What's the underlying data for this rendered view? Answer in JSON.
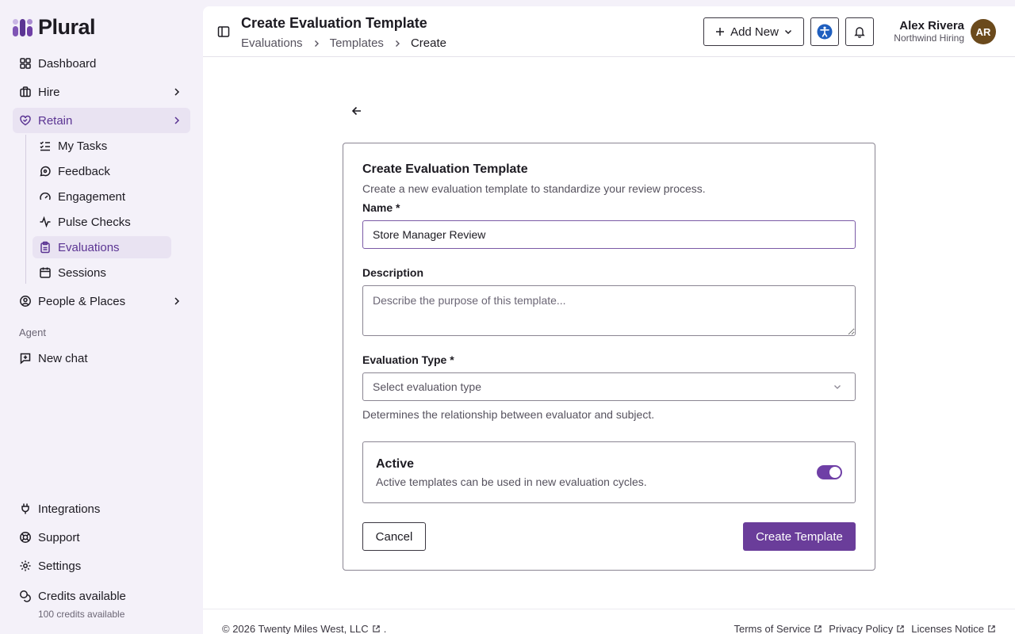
{
  "app": {
    "name": "Plural"
  },
  "sidebar": {
    "items": [
      {
        "label": "Dashboard"
      },
      {
        "label": "Hire"
      },
      {
        "label": "Retain"
      }
    ],
    "retain_sub": [
      {
        "label": "My Tasks"
      },
      {
        "label": "Feedback"
      },
      {
        "label": "Engagement"
      },
      {
        "label": "Pulse Checks"
      },
      {
        "label": "Evaluations"
      },
      {
        "label": "Sessions"
      }
    ],
    "people_places": "People & Places",
    "agent_section": "Agent",
    "new_chat": "New chat",
    "bottom": [
      {
        "label": "Integrations"
      },
      {
        "label": "Support"
      },
      {
        "label": "Settings"
      }
    ],
    "credits_label": "Credits available",
    "credits_sub": "100 credits available"
  },
  "header": {
    "title": "Create Evaluation Template",
    "breadcrumb": [
      "Evaluations",
      "Templates",
      "Create"
    ],
    "add_new": "Add New",
    "user_name": "Alex Rivera",
    "user_org": "Northwind Hiring",
    "avatar_initials": "AR"
  },
  "form": {
    "title": "Create Evaluation Template",
    "subtitle": "Create a new evaluation template to standardize your review process.",
    "name_label": "Name *",
    "name_value": "Store Manager Review",
    "description_label": "Description",
    "description_placeholder": "Describe the purpose of this template...",
    "type_label": "Evaluation Type *",
    "type_placeholder": "Select evaluation type",
    "type_help": "Determines the relationship between evaluator and subject.",
    "active_title": "Active",
    "active_desc": "Active templates can be used in new evaluation cycles.",
    "active_on": true,
    "cancel": "Cancel",
    "submit": "Create Template"
  },
  "footer": {
    "copyright": "© 2026 Twenty Miles West, LLC",
    "copyright_suffix": ".",
    "links": [
      "Terms of Service",
      "Privacy Policy",
      "Licenses Notice"
    ]
  },
  "colors": {
    "accent": "#6a3d9a",
    "sidebar_bg": "#f4f1f9",
    "active_nav_bg": "#e9e3f2",
    "avatar_bg": "#6b4a1c"
  }
}
